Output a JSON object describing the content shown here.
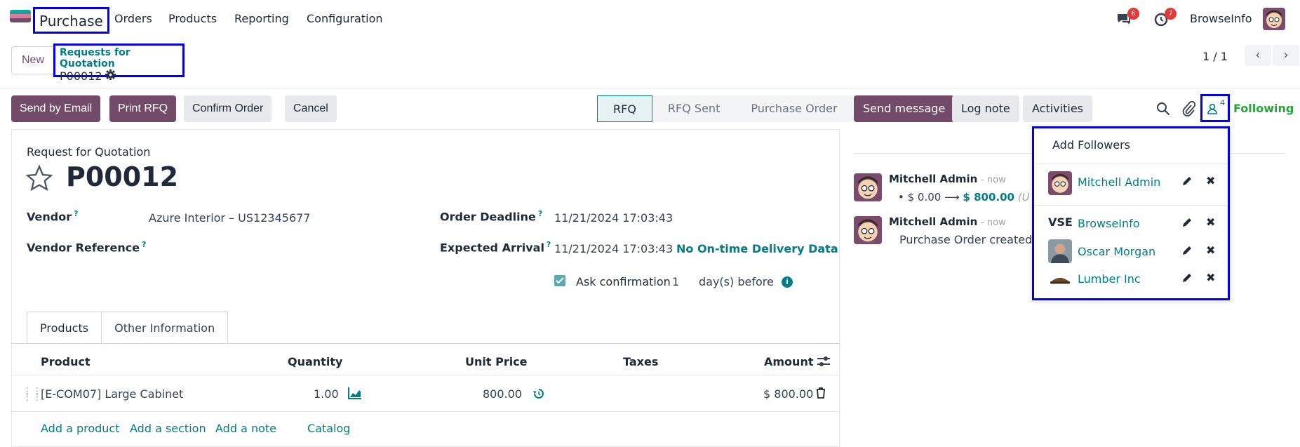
{
  "app": {
    "name": "Purchase",
    "menu": [
      "Orders",
      "Products",
      "Reporting",
      "Configuration"
    ],
    "user": "BrowseInfo",
    "badges": {
      "messages": "6",
      "activities": "7"
    }
  },
  "control": {
    "new_label": "New",
    "breadcrumb_parent": "Requests for Quotation",
    "breadcrumb_current": "P00012",
    "pager": "1 / 1"
  },
  "actions": {
    "send_email": "Send by Email",
    "print_rfq": "Print RFQ",
    "confirm": "Confirm Order",
    "cancel": "Cancel"
  },
  "stages": [
    "RFQ",
    "RFQ Sent",
    "Purchase Order"
  ],
  "form": {
    "doc_type": "Request for Quotation",
    "name": "P00012",
    "vendor_label": "Vendor",
    "vendor_value": "Azure Interior – US12345677",
    "vendor_ref_label": "Vendor Reference",
    "deadline_label": "Order Deadline",
    "deadline_value": "11/21/2024 17:03:43",
    "arrival_label": "Expected Arrival",
    "arrival_value": "11/21/2024 17:03:43",
    "delivery_note": "No On-time Delivery Data",
    "ask_label": "Ask confirmation",
    "ask_days": "1",
    "ask_suffix": "day(s) before",
    "help_mark": "?"
  },
  "tabs": [
    "Products",
    "Other Information"
  ],
  "table": {
    "headers": [
      "Product",
      "Quantity",
      "Unit Price",
      "Taxes",
      "Amount"
    ],
    "rows": [
      {
        "product": "[E-COM07] Large Cabinet",
        "qty": "1.00",
        "price": "800.00",
        "taxes": "",
        "amount": "$ 800.00"
      }
    ],
    "links": [
      "Add a product",
      "Add a section",
      "Add a note",
      "Catalog"
    ]
  },
  "chatter": {
    "send_message": "Send message",
    "log_note": "Log note",
    "activities": "Activities",
    "followers_count": "4",
    "following": "Following",
    "messages": [
      {
        "author": "Mitchell Admin",
        "time": "- now",
        "old": "$ 0.00",
        "arrow": "⟶",
        "new": "$ 800.00",
        "trail": "(U"
      },
      {
        "author": "Mitchell Admin",
        "time": "- now",
        "body": "Purchase Order created"
      }
    ]
  },
  "followers_popup": {
    "title": "Add Followers",
    "followers": [
      "Mitchell Admin",
      "BrowseInfo",
      "Oscar Morgan",
      "Lumber Inc"
    ]
  },
  "colors": {
    "brand": "#714b67",
    "accent": "#017e84",
    "highlight": "#0000ee"
  }
}
